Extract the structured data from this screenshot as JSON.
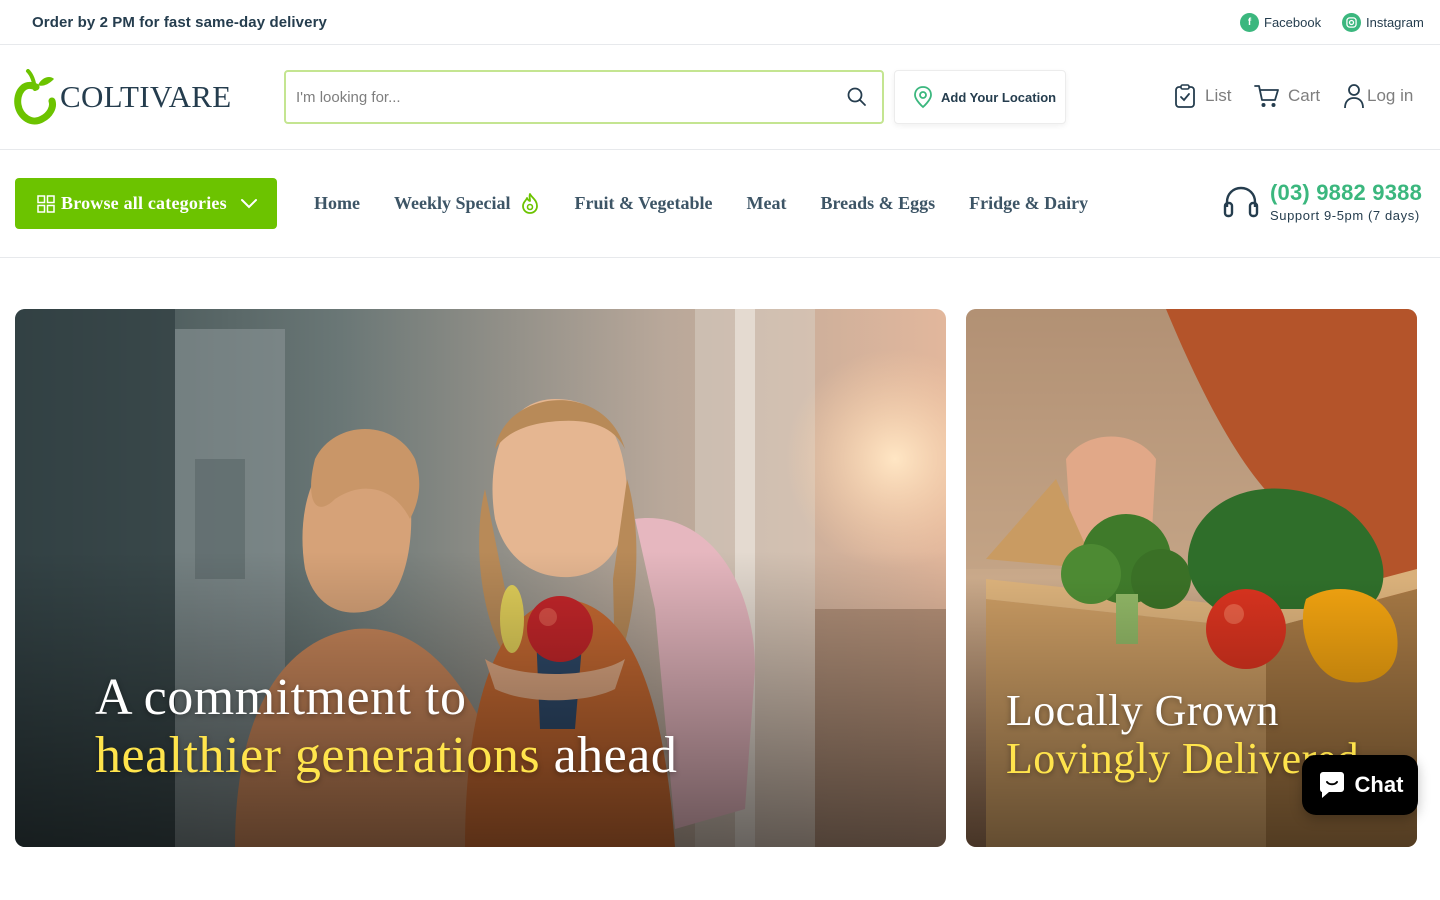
{
  "topbar": {
    "announcement": "Order by 2 PM for fast same-day delivery",
    "social": [
      {
        "label": "Facebook",
        "icon": "facebook-icon"
      },
      {
        "label": "Instagram",
        "icon": "instagram-icon"
      }
    ]
  },
  "header": {
    "logo_text": "COLTIVARE",
    "search": {
      "placeholder": "I'm looking for..."
    },
    "location_label": "Add Your Location",
    "actions": {
      "list": "List",
      "cart": "Cart",
      "login": "Log in"
    }
  },
  "nav": {
    "browse_label": "Browse all categories",
    "links": [
      "Home",
      "Weekly Special",
      "Fruit & Vegetable",
      "Meat",
      "Breads & Eggs",
      "Fridge & Dairy"
    ],
    "support_phone": "(03) 9882 9388",
    "support_hours": "Support 9-5pm (7 days)"
  },
  "hero": {
    "main": {
      "line1": "A commitment to",
      "line2_highlight": "healthier generations",
      "line2_rest": " ahead"
    },
    "side": {
      "line1": "Locally Grown",
      "line2_highlight": "Lovingly Delivered"
    }
  },
  "chat_label": "Chat",
  "colors": {
    "brand_green": "#6cc300",
    "accent_green": "#3bb77e",
    "highlight_yellow": "#ffe44c",
    "text_dark": "#253d4e"
  }
}
